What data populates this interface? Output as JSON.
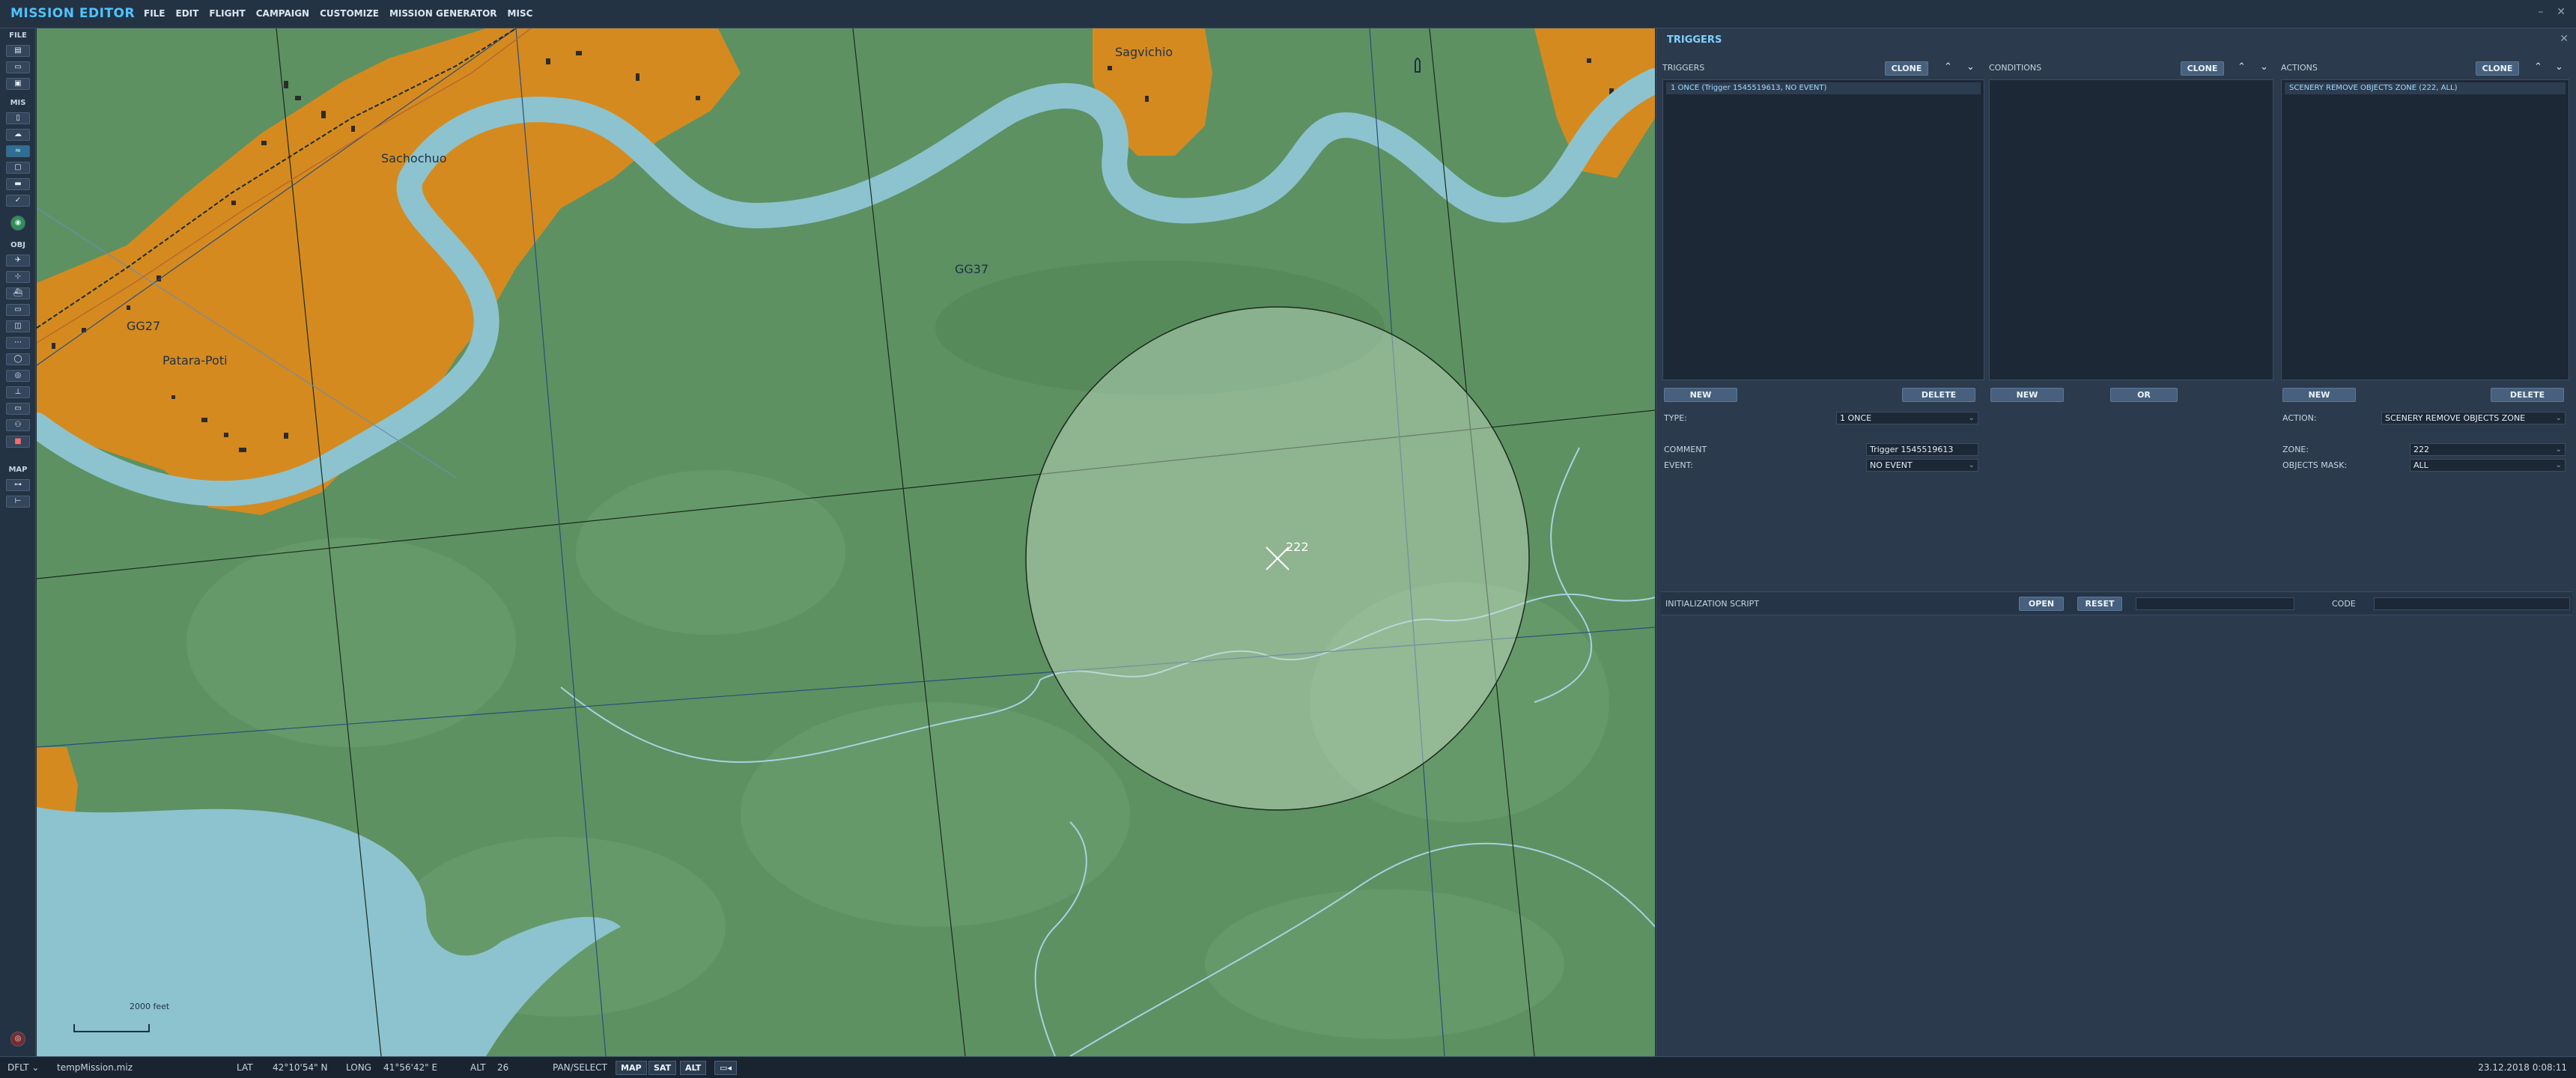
{
  "app": {
    "title": "MISSION EDITOR",
    "menu": [
      "FILE",
      "EDIT",
      "FLIGHT",
      "CAMPAIGN",
      "CUSTOMIZE",
      "MISSION GENERATOR",
      "MISC"
    ]
  },
  "toolbar": {
    "sections": [
      "FILE",
      "MIS",
      "OBJ",
      "MAP"
    ]
  },
  "map": {
    "labels": {
      "town1": "Sachochuo",
      "town2": "Sagvichio",
      "town3": "Patara-Poti",
      "grid1": "GG27",
      "grid2": "GG37"
    },
    "zone_name": "222",
    "scale_label": "2000 feet"
  },
  "panel": {
    "title": "TRIGGERS",
    "triggers": {
      "header": "TRIGGERS",
      "clone": "CLONE",
      "items": [
        "1 ONCE (Trigger 1545519613, NO EVENT)"
      ],
      "new": "NEW",
      "delete": "DELETE"
    },
    "conditions": {
      "header": "CONDITIONS",
      "clone": "CLONE",
      "new": "NEW",
      "or": "OR"
    },
    "actions": {
      "header": "ACTIONS",
      "clone": "CLONE",
      "items": [
        "SCENERY REMOVE OBJECTS ZONE (222, ALL)"
      ],
      "new": "NEW",
      "delete": "DELETE"
    },
    "trigger_props": {
      "type_label": "TYPE:",
      "type_value": "1 ONCE",
      "comment_label": "COMMENT",
      "comment_value": "Trigger 1545519613",
      "event_label": "EVENT:",
      "event_value": "NO EVENT"
    },
    "action_props": {
      "action_label": "ACTION:",
      "action_value": "SCENERY REMOVE OBJECTS ZONE",
      "zone_label": "ZONE:",
      "zone_value": "222",
      "mask_label": "OBJECTS MASK:",
      "mask_value": "ALL"
    },
    "init": {
      "label": "INITIALIZATION SCRIPT",
      "open": "OPEN",
      "reset": "RESET",
      "code_label": "CODE"
    }
  },
  "status": {
    "mode": "DFLT",
    "filename": "tempMission.miz",
    "lat_label": "LAT",
    "lat_value": "42°10'54\" N",
    "long_label": "LONG",
    "long_value": "41°56'42\" E",
    "alt_label": "ALT",
    "alt_value": "26",
    "tool": "PAN/SELECT",
    "map_btn": "MAP",
    "sat_btn": "SAT",
    "alt_btn": "ALT",
    "datetime": "23.12.2018 0:08:11"
  },
  "colors": {
    "accent": "#4fc3ff",
    "terrain": "#5d9162",
    "water": "#8cc3cf",
    "town": "#d58a1f",
    "zone_fill": "#c9e0c9"
  }
}
